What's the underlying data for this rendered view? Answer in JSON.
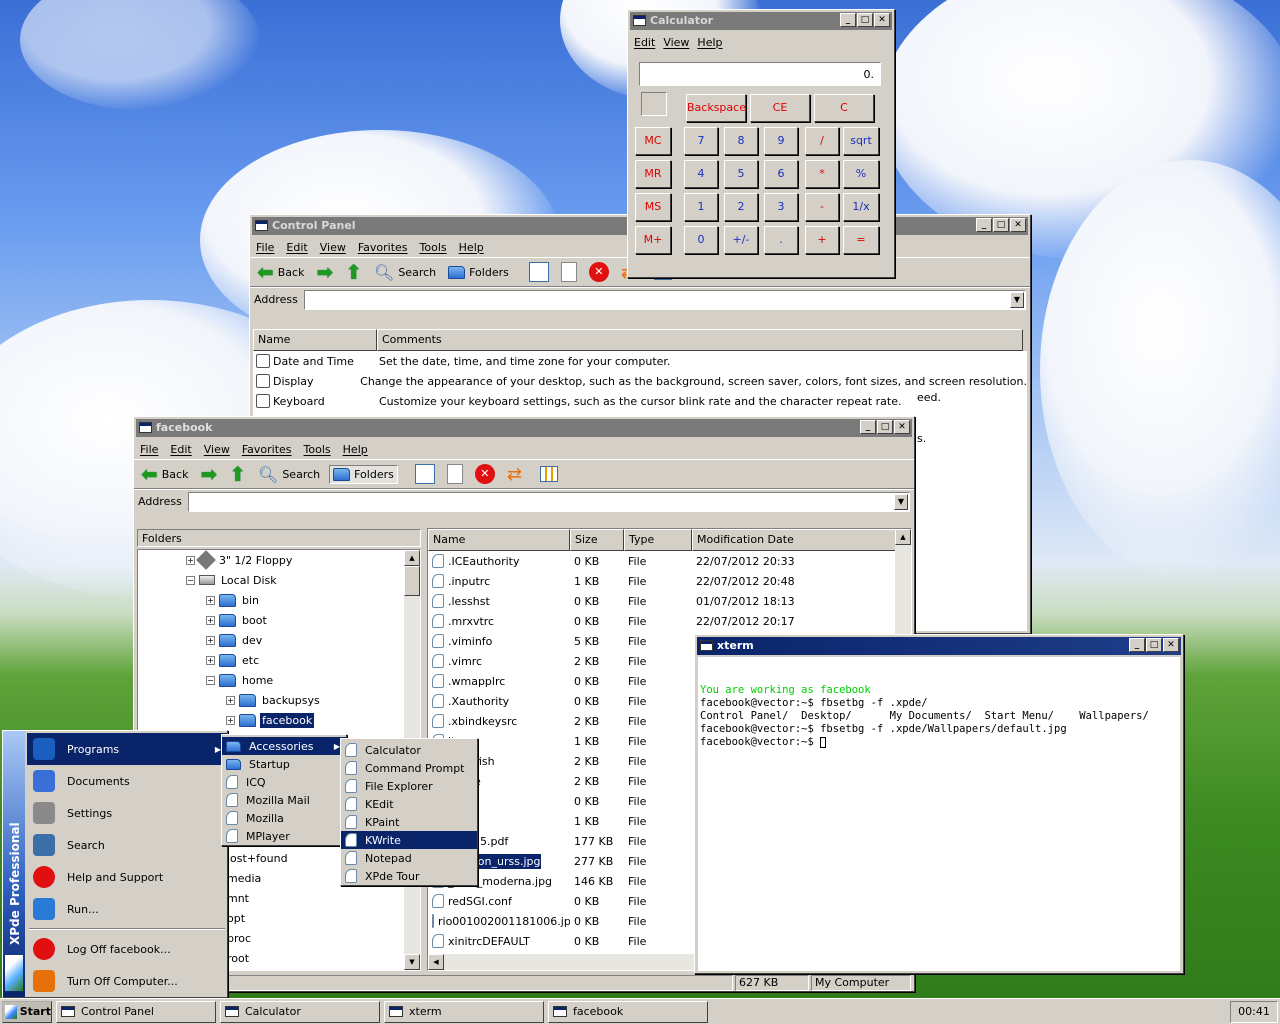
{
  "calculator": {
    "title": "Calculator",
    "menu": [
      "Edit",
      "View",
      "Help"
    ],
    "display": "0.",
    "top_buttons": [
      "Backspace",
      "CE",
      "C"
    ],
    "memory_buttons": [
      "MC",
      "MR",
      "MS",
      "M+"
    ],
    "keypad": [
      [
        "7",
        "8",
        "9",
        "/",
        "sqrt"
      ],
      [
        "4",
        "5",
        "6",
        "*",
        "%"
      ],
      [
        "1",
        "2",
        "3",
        "-",
        "1/x"
      ],
      [
        "0",
        "+/-",
        ".",
        "+",
        "="
      ]
    ]
  },
  "control_panel": {
    "title": "Control Panel",
    "menu": [
      "File",
      "Edit",
      "View",
      "Favorites",
      "Tools",
      "Help"
    ],
    "toolbar": {
      "back": "Back",
      "search": "Search",
      "folders": "Folders"
    },
    "address_label": "Address",
    "columns": [
      "Name",
      "Comments"
    ],
    "rows": [
      {
        "name": "Date and Time",
        "comment": "Set the date, time, and time zone for your computer."
      },
      {
        "name": "Display",
        "comment": "Change the appearance of your desktop, such as the background, screen saver, colors, font sizes, and screen resolution."
      },
      {
        "name": "Keyboard",
        "comment": "Customize your keyboard settings, such as the cursor blink rate and the character repeat rate."
      }
    ],
    "partial_text": [
      "eed.",
      "s."
    ]
  },
  "facebook": {
    "title": "facebook",
    "menu": [
      "File",
      "Edit",
      "View",
      "Favorites",
      "Tools",
      "Help"
    ],
    "toolbar": {
      "back": "Back",
      "search": "Search",
      "folders": "Folders"
    },
    "address_label": "Address",
    "folders_label": "Folders",
    "tree": [
      {
        "label": "3\" 1/2 Floppy",
        "depth": 0
      },
      {
        "label": "Local Disk",
        "depth": 0
      },
      {
        "label": "bin",
        "depth": 1
      },
      {
        "label": "boot",
        "depth": 1
      },
      {
        "label": "dev",
        "depth": 1
      },
      {
        "label": "etc",
        "depth": 1
      },
      {
        "label": "home",
        "depth": 1
      },
      {
        "label": "backupsys",
        "depth": 2
      },
      {
        "label": "facebook",
        "depth": 2,
        "selected": true
      }
    ],
    "tree_lower": [
      "lost+found",
      "media",
      "mnt",
      "opt",
      "proc",
      "root"
    ],
    "columns": [
      "Name",
      "Size",
      "Type",
      "Modification Date"
    ],
    "files": [
      {
        "name": ".ICEauthority",
        "size": "0 KB",
        "type": "File",
        "date": "22/07/2012 20:33"
      },
      {
        "name": ".inputrc",
        "size": "1 KB",
        "type": "File",
        "date": "22/07/2012 20:48"
      },
      {
        "name": ".lesshst",
        "size": "0 KB",
        "type": "File",
        "date": "01/07/2012 18:13"
      },
      {
        "name": ".mrxvtrc",
        "size": "0 KB",
        "type": "File",
        "date": "22/07/2012 20:17"
      },
      {
        "name": ".viminfo",
        "size": "5 KB",
        "type": "File",
        "date": "2"
      },
      {
        "name": ".vimrc",
        "size": "2 KB",
        "type": "File",
        "date": "2"
      },
      {
        "name": ".wmapplrc",
        "size": "0 KB",
        "type": "File",
        "date": "2"
      },
      {
        "name": ".Xauthority",
        "size": "0 KB",
        "type": "File",
        "date": "2"
      },
      {
        "name": ".xbindkeysrc",
        "size": "2 KB",
        "type": "File",
        "date": "2"
      },
      {
        "name": "lts",
        "size": "1 KB",
        "type": "File",
        "date": "1"
      },
      {
        "name": "_sawfish",
        "size": "2 KB",
        "type": "File",
        "date": "1"
      },
      {
        "name": "_xpde",
        "size": "2 KB",
        "type": "File",
        "date": "1"
      },
      {
        "name": "nap",
        "size": "0 KB",
        "type": "File",
        "date": "1"
      },
      {
        "name": "on",
        "size": "1 KB",
        "type": "File",
        "date": "1"
      },
      {
        "name": "0-2015.pdf",
        "size": "177 KB",
        "type": "File",
        "date": "2"
      },
      {
        "name": "_carbon_urss.jpg",
        "size": "277 KB",
        "type": "File",
        "date": "1",
        "selected": true
      },
      {
        "name": "_vida_moderna.jpg",
        "size": "146 KB",
        "type": "File",
        "date": "2"
      },
      {
        "name": "redSGI.conf",
        "size": "0 KB",
        "type": "File",
        "date": "1"
      },
      {
        "name": "rio001002001181006.jpg",
        "size": "0 KB",
        "type": "File",
        "date": "2"
      },
      {
        "name": "xinitrcDEFAULT",
        "size": "0 KB",
        "type": "File",
        "date": "2"
      }
    ],
    "status": {
      "size": "627 KB",
      "location": "My Computer"
    }
  },
  "xterm": {
    "title": "xterm",
    "lines": [
      {
        "text": "You are working as facebook",
        "color": "#00d000"
      },
      {
        "text": "facebook@vector:~$ fbsetbg -f .xpde/",
        "color": "#000000"
      },
      {
        "text": "Control Panel/  Desktop/      My Documents/  Start Menu/    Wallpapers/",
        "color": "#000000"
      },
      {
        "text": "facebook@vector:~$ fbsetbg -f .xpde/Wallpapers/default.jpg",
        "color": "#000000"
      },
      {
        "text": "facebook@vector:~$ ",
        "color": "#000000"
      }
    ]
  },
  "start_menu": {
    "banner": "XPde Professional",
    "items": [
      "Programs",
      "Documents",
      "Settings",
      "Search",
      "Help and Support",
      "Run..."
    ],
    "bottom": [
      "Log Off facebook...",
      "Turn Off Computer..."
    ]
  },
  "programs_menu": [
    "Accessories",
    "Startup",
    "ICQ",
    "Mozilla Mail",
    "Mozilla",
    "MPlayer"
  ],
  "accessories_menu": [
    "Calculator",
    "Command Prompt",
    "File Explorer",
    "KEdit",
    "KPaint",
    "KWrite",
    "Notepad",
    "XPde Tour"
  ],
  "taskbar": {
    "start": "Start",
    "tasks": [
      "Control Panel",
      "Calculator",
      "xterm",
      "facebook"
    ],
    "clock": "00:41"
  }
}
